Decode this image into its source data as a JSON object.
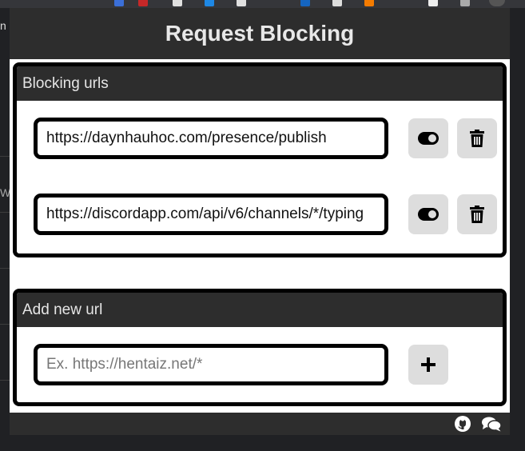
{
  "popup": {
    "title": "Request Blocking"
  },
  "blocking_section": {
    "header": "Blocking urls",
    "items": [
      {
        "url": "https://daynhauhoc.com/presence/publish",
        "toggle_icon": "toggle-on-icon",
        "delete_icon": "trash-icon"
      },
      {
        "url": "https://discordapp.com/api/v6/channels/*/typing",
        "toggle_icon": "toggle-on-icon",
        "delete_icon": "trash-icon"
      }
    ]
  },
  "add_section": {
    "header": "Add new url",
    "placeholder": "Ex. https://hentaiz.net/*",
    "value": "",
    "add_icon": "plus-icon"
  },
  "footer": {
    "icons": [
      "github-icon",
      "comments-icon"
    ]
  },
  "background": {
    "left_text": "n",
    "left_w": "W"
  }
}
